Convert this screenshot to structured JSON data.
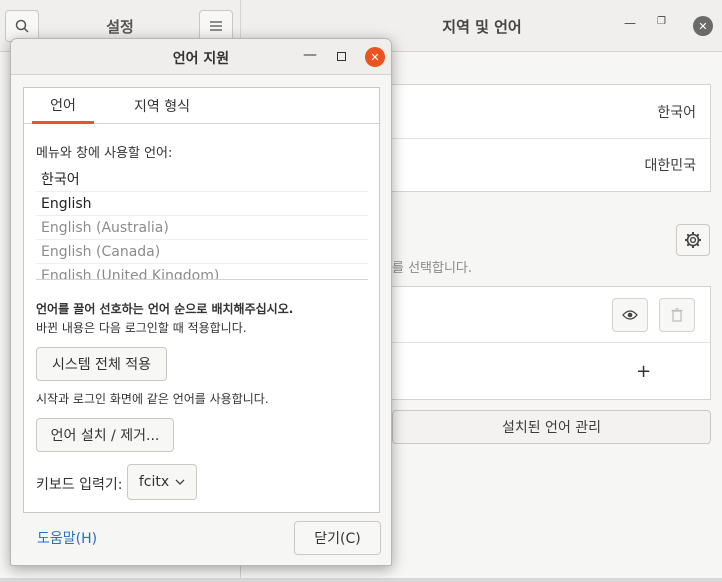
{
  "background_window": {
    "sidebar_title": "설정",
    "title": "지역 및 언어",
    "rows": [
      "한국어",
      "대한민국"
    ],
    "partial_text": "를 선택합니다.",
    "add_symbol": "+",
    "manage_button": "설치된 언어 관리",
    "icons": {
      "search": "search-icon",
      "menu": "hamburger-menu-icon",
      "gear": "gear-icon",
      "eye": "eye-icon",
      "trash": "trash-icon"
    }
  },
  "dialog": {
    "title": "언어 지원",
    "tabs": [
      {
        "label": "언어",
        "active": true
      },
      {
        "label": "지역 형식",
        "active": false
      }
    ],
    "list_label": "메뉴와 창에 사용할 언어:",
    "languages": [
      {
        "name": "한국어",
        "enabled": true
      },
      {
        "name": "English",
        "enabled": true
      },
      {
        "name": "English (Australia)",
        "enabled": false
      },
      {
        "name": "English (Canada)",
        "enabled": false
      },
      {
        "name": "English (United Kingdom)",
        "enabled": false
      }
    ],
    "drag_note": "언어를 끌어 선호하는 언어 순으로 배치해주십시오.",
    "apply_note": "바뀐 내용은 다음 로그인할 때 적용합니다.",
    "apply_system_button": "시스템 전체 적용",
    "login_note": "시작과 로그인 화면에 같은 언어를 사용합니다.",
    "install_button": "언어 설치 / 제거...",
    "keyboard_label": "키보드 입력기:",
    "keyboard_value": "fcitx",
    "help_link": "도움말(H)",
    "close_button": "닫기(C)",
    "accent_color": "#e95420",
    "link_color": "#2a6ebb"
  }
}
